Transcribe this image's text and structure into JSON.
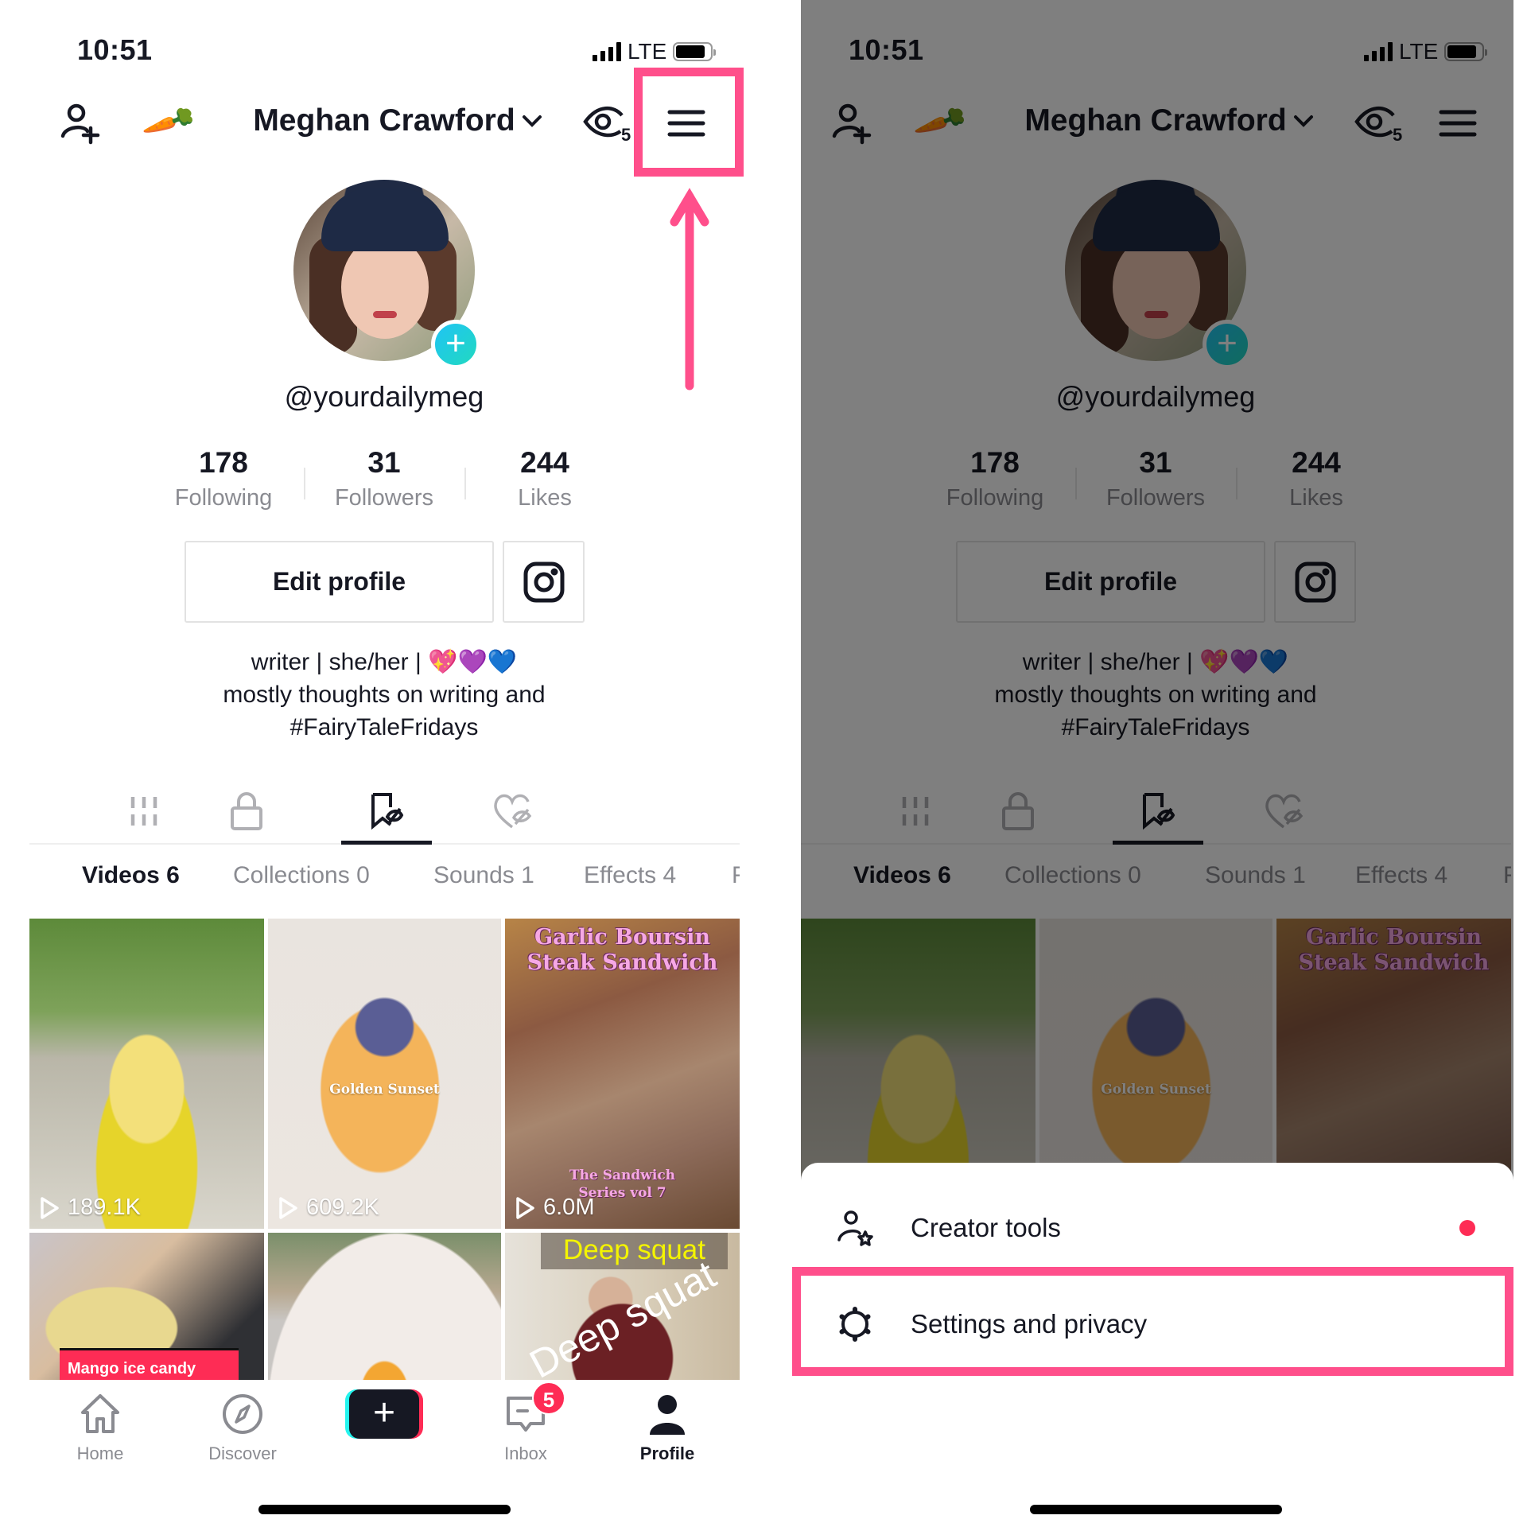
{
  "status_bar": {
    "time": "10:51",
    "network": "LTE",
    "signal_bars": 4,
    "battery_level": 0.85
  },
  "header": {
    "add_user_icon": "person-plus-icon",
    "carrot_emoji": "🥕",
    "profile_name": "Meghan Crawford",
    "views_icon": "eye-icon",
    "views_badge": "5",
    "menu_icon": "hamburger-menu-icon"
  },
  "profile": {
    "username": "@yourdailymeg",
    "stats": [
      {
        "value": "178",
        "label": "Following"
      },
      {
        "value": "31",
        "label": "Followers"
      },
      {
        "value": "244",
        "label": "Likes"
      }
    ],
    "edit_profile_label": "Edit profile",
    "bio_lines": [
      "writer | she/her | 💖💜💙",
      "mostly thoughts on writing and",
      "#FairyTaleFridays"
    ]
  },
  "icon_tabs": [
    {
      "name": "videos-grid-icon",
      "active": false
    },
    {
      "name": "private-lock-icon",
      "active": false
    },
    {
      "name": "favorites-bookmark-icon",
      "active": true
    },
    {
      "name": "liked-heart-icon",
      "active": false
    }
  ],
  "sub_tabs": [
    {
      "label": "Videos 6",
      "active": true
    },
    {
      "label": "Collections 0",
      "active": false
    },
    {
      "label": "Sounds 1",
      "active": false
    },
    {
      "label": "Effects 4",
      "active": false
    },
    {
      "label": "F",
      "active": false
    }
  ],
  "videos": [
    {
      "views": "189.1K",
      "title": ""
    },
    {
      "views": "609.2K",
      "title": "Golden Sunset"
    },
    {
      "views": "6.0M",
      "title": "Garlic Boursin Steak Sandwich",
      "subtitle": "The Sandwich Series vol 7"
    },
    {
      "views": "",
      "title": "Mango ice candy"
    },
    {
      "views": "",
      "title": ""
    },
    {
      "views": "",
      "title": "Deep squat",
      "overlay_text": "Deep squat"
    }
  ],
  "bottom_nav": [
    {
      "label": "Home",
      "icon": "home-icon",
      "active": false
    },
    {
      "label": "Discover",
      "icon": "compass-icon",
      "active": false
    },
    {
      "label": "",
      "icon": "create-plus-icon",
      "active": false
    },
    {
      "label": "Inbox",
      "icon": "inbox-icon",
      "active": false,
      "badge": "5"
    },
    {
      "label": "Profile",
      "icon": "profile-icon",
      "active": true
    }
  ],
  "menu_sheet": {
    "items": [
      {
        "label": "Creator tools",
        "icon": "creator-tools-icon",
        "has_dot": true
      },
      {
        "label": "Settings and privacy",
        "icon": "settings-gear-icon",
        "has_dot": false
      }
    ]
  },
  "colors": {
    "highlight": "#ff4f8b",
    "tiktok_red": "#fe2c55",
    "tiktok_cyan": "#25f4ee",
    "text_primary": "#161823",
    "text_secondary": "#8a8b91"
  }
}
